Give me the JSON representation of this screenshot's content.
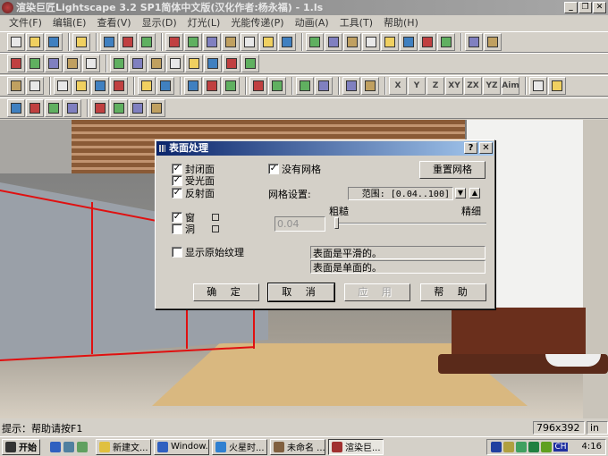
{
  "window": {
    "title": "渲染巨匠Lightscape 3.2 SP1简体中文版(汉化作者:杨永福) - 1.ls",
    "minimize": "_",
    "restore": "❐",
    "close": "✕"
  },
  "menu": [
    "文件(F)",
    "编辑(E)",
    "查看(V)",
    "显示(D)",
    "灯光(L)",
    "光能传递(P)",
    "动画(A)",
    "工具(T)",
    "帮助(H)"
  ],
  "toolbars": [
    [
      [
        "new",
        "open",
        "save"
      ],
      [
        "undo"
      ],
      [
        "print",
        "help",
        "context-help"
      ],
      [
        "select",
        "cube",
        "cube",
        "cube",
        "cube",
        "cube",
        "cube"
      ],
      [
        "zoom-tool",
        "eye",
        "orbit",
        "zoom-in",
        "zoom",
        "pan",
        "landscape",
        "rotate"
      ],
      [
        "zoom-window",
        "zoom-extents"
      ]
    ],
    [
      [
        "wireframe",
        "solid",
        "shaded",
        "green-cube",
        "green-cube2"
      ],
      [
        "camera",
        "camera2",
        "camera3",
        "line",
        "light",
        "globe",
        "texture",
        "render"
      ]
    ],
    [
      [
        "pointer",
        "select-group"
      ],
      [
        "sel1",
        "sel2",
        "sel3",
        "sel4"
      ],
      [
        "page",
        "page2"
      ],
      [
        "arrow",
        "arrow2",
        "arrow3"
      ],
      [
        "layer",
        "filter"
      ],
      [
        "add",
        "edit"
      ],
      [
        "move",
        "rotate"
      ],
      [
        "X",
        "Y",
        "Z",
        "XY",
        "ZX",
        "YZ",
        "Aim"
      ],
      [
        "eraser",
        "pencil"
      ]
    ],
    [
      [
        "walk",
        "run",
        "figure",
        "pen"
      ],
      [
        "layers",
        "globe-green",
        "layers2",
        "undo-curve"
      ]
    ]
  ],
  "dialog": {
    "title": "表面处理",
    "help_btn": "?",
    "close_btn": "✕",
    "checkboxes": [
      {
        "label": "封闭面",
        "checked": true
      },
      {
        "label": "受光面",
        "checked": true
      },
      {
        "label": "反射面",
        "checked": true
      },
      {
        "label": "窗",
        "checked": true
      },
      {
        "label": "洞",
        "checked": false
      },
      {
        "label": "显示原始纹理",
        "checked": false
      },
      {
        "label": "没有网格",
        "checked": true
      }
    ],
    "mesh_label": "网格设置:",
    "range": "范围: [0.04..100]",
    "coarse": "粗糙",
    "fine": "精细",
    "value": "0.04",
    "slider_value": 0.04,
    "reset_btn": "重置网格",
    "info": [
      "表面是平滑的。",
      "表面是单面的。"
    ],
    "buttons": {
      "ok": "确 定",
      "cancel": "取 消",
      "apply": "应 用",
      "help": "帮 助"
    },
    "spin_down": "▼",
    "spin_up": "▲"
  },
  "status": {
    "hint": "提示：帮助请按F1",
    "resolution": "796x392",
    "unit": "in"
  },
  "taskbar": {
    "start": "开始",
    "items": [
      "新建文...",
      "Window...",
      "火星时...",
      "未命名 ...",
      "渲染巨..."
    ],
    "time": "4:16",
    "ime": "CH"
  }
}
